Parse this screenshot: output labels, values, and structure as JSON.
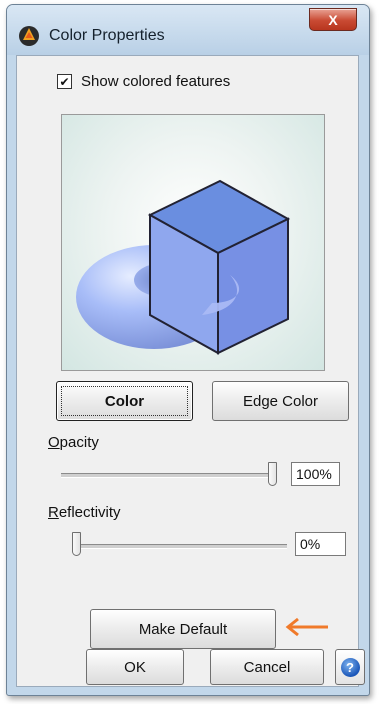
{
  "window": {
    "title": "Color Properties",
    "close_label": "X",
    "app_icon": "app-logo-icon"
  },
  "show_colored": {
    "label": "Show colored features",
    "checked": true,
    "check_glyph": "✔"
  },
  "preview": {
    "description_icon": "cube-torus-preview",
    "colors": {
      "top": "#6a8ee0",
      "left": "#8fa7ee",
      "right": "#7790e4",
      "torus": "#a8bdf8",
      "edge": "#222233"
    }
  },
  "buttons": {
    "color": "Color",
    "edge_color": "Edge Color",
    "make_default": "Make Default",
    "ok": "OK",
    "cancel": "Cancel",
    "help": "?"
  },
  "opacity": {
    "label_prefix": "O",
    "label_rest": "pacity",
    "value": "100%",
    "level": 1.0
  },
  "reflectivity": {
    "label_prefix": "R",
    "label_rest": "eflectivity",
    "value": "0%",
    "level": 0.0
  },
  "annotation": {
    "arrow_color": "#f07a2a"
  }
}
